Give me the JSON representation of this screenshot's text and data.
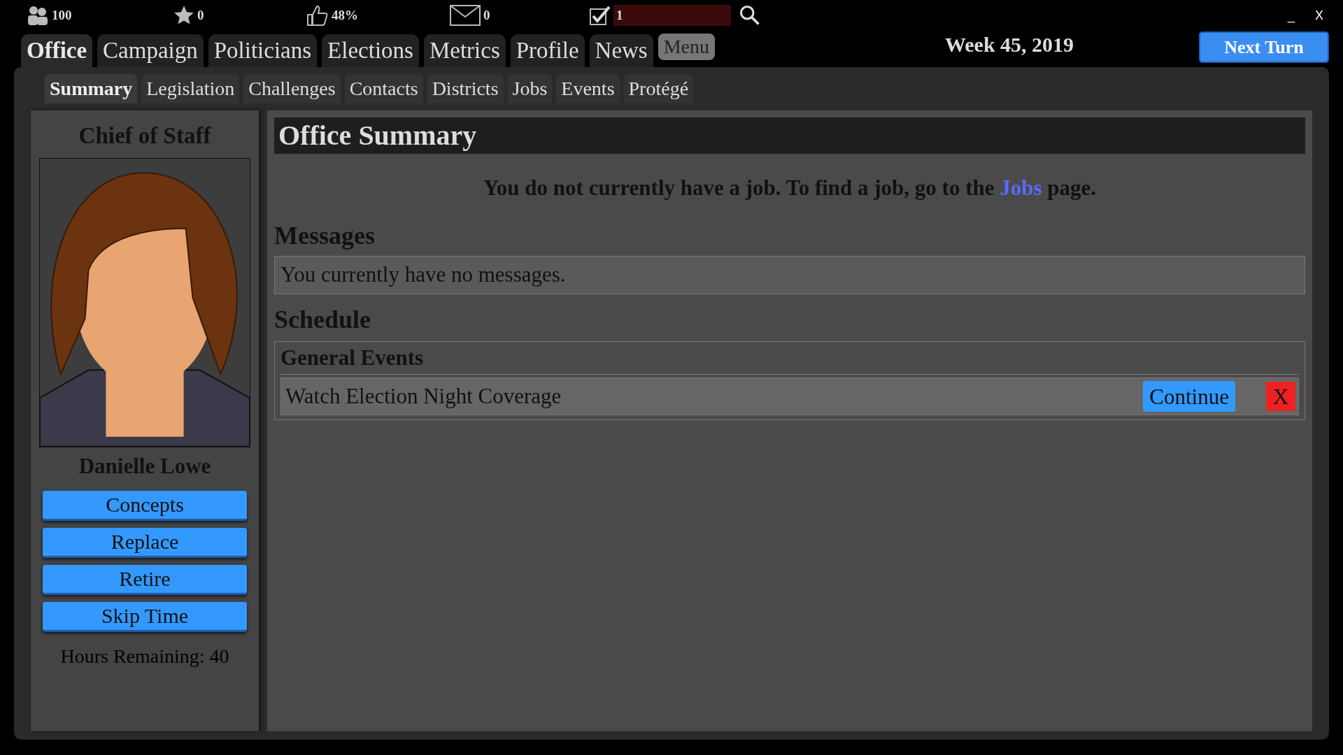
{
  "stats": [
    {
      "kind": "people",
      "value": "100"
    },
    {
      "kind": "star",
      "value": "0"
    },
    {
      "kind": "approval",
      "value": "48%"
    },
    {
      "kind": "mail",
      "value": "0"
    },
    {
      "kind": "tasks",
      "value": "1"
    }
  ],
  "window_controls": [
    "_",
    "X"
  ],
  "main_tabs": [
    {
      "label": "Office",
      "selected": true
    },
    {
      "label": "Campaign",
      "selected": false
    },
    {
      "label": "Politicians",
      "selected": false
    },
    {
      "label": "Elections",
      "selected": false
    },
    {
      "label": "Metrics",
      "selected": false
    },
    {
      "label": "Profile",
      "selected": false
    },
    {
      "label": "News",
      "selected": false
    }
  ],
  "menu_button": "Menu",
  "date": "Week 45, 2019",
  "next_turn": "Next Turn",
  "sub_tabs": [
    {
      "label": "Summary",
      "selected": true
    },
    {
      "label": "Legislation",
      "selected": false
    },
    {
      "label": "Challenges",
      "selected": false
    },
    {
      "label": "Contacts",
      "selected": false
    },
    {
      "label": "Districts",
      "selected": false
    },
    {
      "label": "Jobs",
      "selected": false
    },
    {
      "label": "Events",
      "selected": false
    },
    {
      "label": "Protégé",
      "selected": false
    }
  ],
  "sidebar": {
    "title": "Chief of Staff",
    "name": "Danielle Lowe",
    "buttons": [
      "Concepts",
      "Replace",
      "Retire",
      "Skip Time"
    ],
    "hours": "Hours Remaining: 40"
  },
  "content": {
    "title": "Office Summary",
    "job_text_before": "You do not currently have a job. To find a job, go to the",
    "job_link": "Jobs",
    "job_text_after": "page.",
    "messages_heading": "Messages",
    "messages_text": "You currently have no messages.",
    "schedule_heading": "Schedule",
    "event_groups": [
      {
        "title": "General Events",
        "events": [
          {
            "name": "Watch Election Night Coverage",
            "action": "Continue",
            "dismiss": "X"
          }
        ]
      }
    ]
  }
}
